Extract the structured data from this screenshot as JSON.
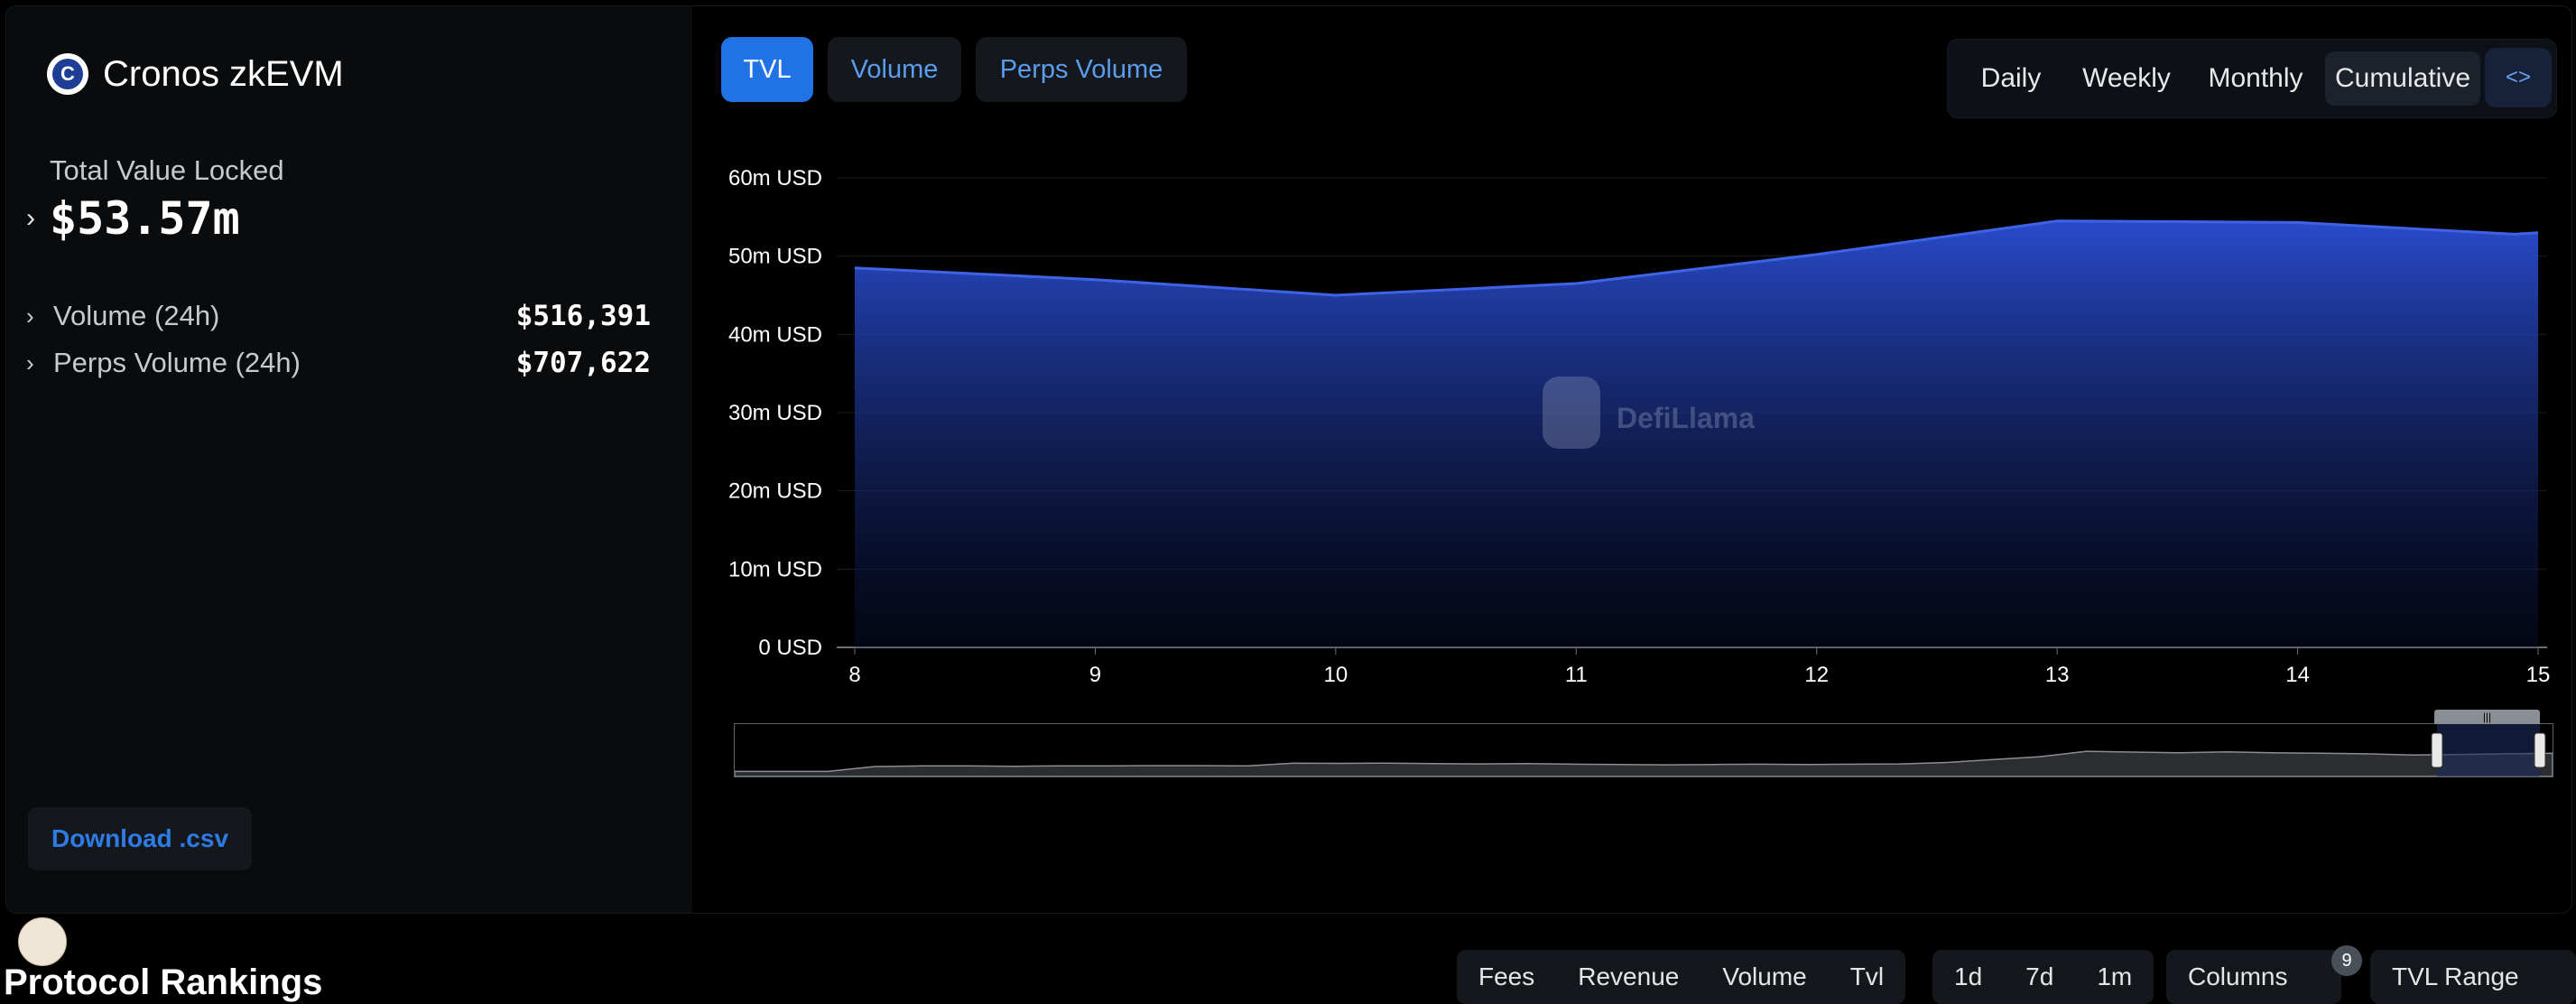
{
  "chain": {
    "name": "Cronos zkEVM",
    "logo_letter": "C"
  },
  "summary": {
    "tvl_label": "Total Value Locked",
    "tvl_value": "$53.57m",
    "stats": [
      {
        "label": "Volume (24h)",
        "value": "$516,391"
      },
      {
        "label": "Perps Volume (24h)",
        "value": "$707,622"
      }
    ]
  },
  "download_label": "Download .csv",
  "metric_tabs": [
    "TVL",
    "Volume",
    "Perps Volume"
  ],
  "active_metric": "TVL",
  "granularity": {
    "options": [
      "Daily",
      "Weekly",
      "Monthly",
      "Cumulative"
    ],
    "active": "Cumulative",
    "embed_label": "<>"
  },
  "watermark": "DefiLlama",
  "chart_data": {
    "type": "area",
    "x": [
      8,
      9,
      10,
      11,
      12,
      13,
      14,
      15
    ],
    "x_ticks": [
      "8",
      "9",
      "10",
      "11",
      "12",
      "13",
      "14",
      "15"
    ],
    "series": [
      {
        "values_m_usd": [
          48.5,
          47.0,
          45.0,
          46.5,
          50.2,
          54.5,
          54.3,
          52.8,
          53.0
        ]
      }
    ],
    "x_points": [
      8,
      9,
      10,
      11,
      12,
      13,
      14,
      14.9,
      15
    ],
    "y_ticks": [
      "0 USD",
      "10m USD",
      "20m USD",
      "30m USD",
      "40m USD",
      "50m USD",
      "60m USD"
    ],
    "ylim": [
      0,
      60
    ],
    "grid": true,
    "color": "#2b4fd6"
  },
  "brush": {
    "grip_label": "|||"
  },
  "rankings": {
    "title": "Protocol Rankings",
    "group1": [
      "Fees",
      "Revenue",
      "Volume",
      "Tvl"
    ],
    "group2": [
      "1d",
      "7d",
      "1m"
    ],
    "columns_label": "Columns",
    "columns_badge": "9",
    "tvl_range_label": "TVL Range"
  }
}
